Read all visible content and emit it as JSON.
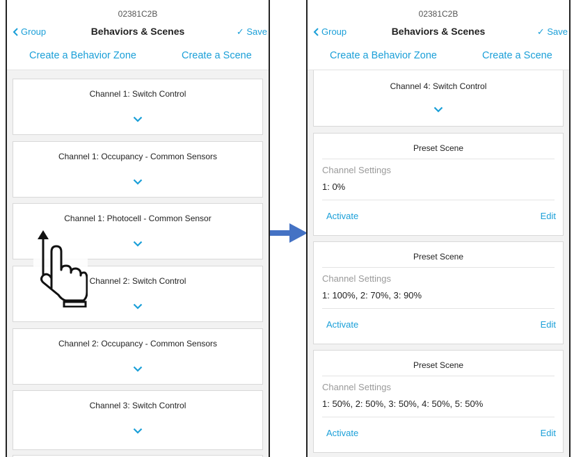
{
  "left": {
    "device_id": "02381C2B",
    "nav": {
      "back_label": "Group",
      "title": "Behaviors & Scenes",
      "save_label": "✓ Save"
    },
    "links": {
      "behavior_zone": "Create a Behavior Zone",
      "scene": "Create a Scene"
    },
    "cards": [
      "Channel 1: Switch Control",
      "Channel 1: Occupancy - Common Sensors",
      "Channel 1: Photocell - Common Sensor",
      "Channel 2: Switch Control",
      "Channel 2: Occupancy - Common Sensors",
      "Channel 3: Switch Control"
    ]
  },
  "right": {
    "device_id": "02381C2B",
    "nav": {
      "back_label": "Group",
      "title": "Behaviors & Scenes",
      "save_label": "✓ Save"
    },
    "links": {
      "behavior_zone": "Create a Behavior Zone",
      "scene": "Create a Scene"
    },
    "top_card": "Channel 4: Switch Control",
    "scenes": [
      {
        "title": "Preset Scene",
        "settings_label": "Channel Settings",
        "settings_value": "1: 0%",
        "activate": "Activate",
        "edit": "Edit"
      },
      {
        "title": "Preset Scene",
        "settings_label": "Channel Settings",
        "settings_value": "1: 100%, 2: 70%, 3: 90%",
        "activate": "Activate",
        "edit": "Edit"
      },
      {
        "title": "Preset Scene",
        "settings_label": "Channel Settings",
        "settings_value": "1: 50%, 2: 50%, 3: 50%, 4: 50%, 5: 50%",
        "activate": "Activate",
        "edit": "Edit"
      }
    ]
  },
  "icons": {
    "back": "chevron-left-icon",
    "expand": "chevron-down-icon",
    "transition": "arrow-right-icon",
    "gesture": "swipe-up-hand-icon"
  },
  "colors": {
    "accent": "#1a9fd8",
    "arrow": "#4472c4",
    "background": "#f2f2f2"
  }
}
